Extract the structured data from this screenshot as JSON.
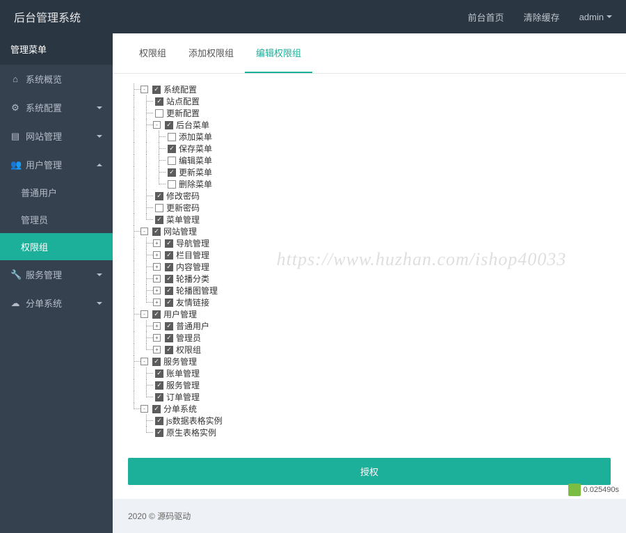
{
  "brand": "后台管理系统",
  "topbar": {
    "frontend": "前台首页",
    "clear_cache": "清除缓存",
    "user": "admin"
  },
  "sidebar": {
    "title": "管理菜单",
    "items": [
      {
        "label": "系统概览",
        "icon": "⌂",
        "expand": null
      },
      {
        "label": "系统配置",
        "icon": "⚙",
        "expand": "down"
      },
      {
        "label": "网站管理",
        "icon": "▤",
        "expand": "down"
      },
      {
        "label": "用户管理",
        "icon": "👥",
        "expand": "up",
        "active_group": true,
        "children": [
          {
            "label": "普通用户"
          },
          {
            "label": "管理员"
          },
          {
            "label": "权限组",
            "active": true
          }
        ]
      },
      {
        "label": "服务管理",
        "icon": "🔧",
        "expand": "down"
      },
      {
        "label": "分单系统",
        "icon": "☁",
        "expand": "down"
      }
    ]
  },
  "tabs": [
    {
      "label": "权限组",
      "active": false
    },
    {
      "label": "添加权限组",
      "active": false
    },
    {
      "label": "编辑权限组",
      "active": true
    }
  ],
  "tree": [
    {
      "label": "系统配置",
      "checked": true,
      "toggle": "-",
      "children": [
        {
          "label": "站点配置",
          "checked": true
        },
        {
          "label": "更新配置",
          "checked": false
        },
        {
          "label": "后台菜单",
          "checked": true,
          "toggle": "-",
          "children": [
            {
              "label": "添加菜单",
              "checked": false
            },
            {
              "label": "保存菜单",
              "checked": true
            },
            {
              "label": "编辑菜单",
              "checked": false
            },
            {
              "label": "更新菜单",
              "checked": true
            },
            {
              "label": "删除菜单",
              "checked": false
            }
          ]
        },
        {
          "label": "修改密码",
          "checked": true
        },
        {
          "label": "更新密码",
          "checked": false
        },
        {
          "label": "菜单管理",
          "checked": true
        }
      ]
    },
    {
      "label": "网站管理",
      "checked": true,
      "toggle": "-",
      "children": [
        {
          "label": "导航管理",
          "checked": true,
          "toggle": "+"
        },
        {
          "label": "栏目管理",
          "checked": true,
          "toggle": "+"
        },
        {
          "label": "内容管理",
          "checked": true,
          "toggle": "+"
        },
        {
          "label": "轮播分类",
          "checked": true,
          "toggle": "+"
        },
        {
          "label": "轮播图管理",
          "checked": true,
          "toggle": "+"
        },
        {
          "label": "友情链接",
          "checked": true,
          "toggle": "+"
        }
      ]
    },
    {
      "label": "用户管理",
      "checked": true,
      "toggle": "-",
      "children": [
        {
          "label": "普通用户",
          "checked": true,
          "toggle": "+"
        },
        {
          "label": "管理员",
          "checked": true,
          "toggle": "+"
        },
        {
          "label": "权限组",
          "checked": true,
          "toggle": "+"
        }
      ]
    },
    {
      "label": "服务管理",
      "checked": true,
      "toggle": "-",
      "children": [
        {
          "label": "账单管理",
          "checked": true
        },
        {
          "label": "服务管理",
          "checked": true
        },
        {
          "label": "订单管理",
          "checked": true
        }
      ]
    },
    {
      "label": "分单系统",
      "checked": true,
      "toggle": "-",
      "children": [
        {
          "label": "js数据表格实例",
          "checked": true
        },
        {
          "label": "原生表格实例",
          "checked": true
        }
      ]
    }
  ],
  "auth_button": "授权",
  "footer": "2020 © 源码驱动",
  "watermark": "https://www.huzhan.com/ishop40033",
  "timing": "0.025490s"
}
